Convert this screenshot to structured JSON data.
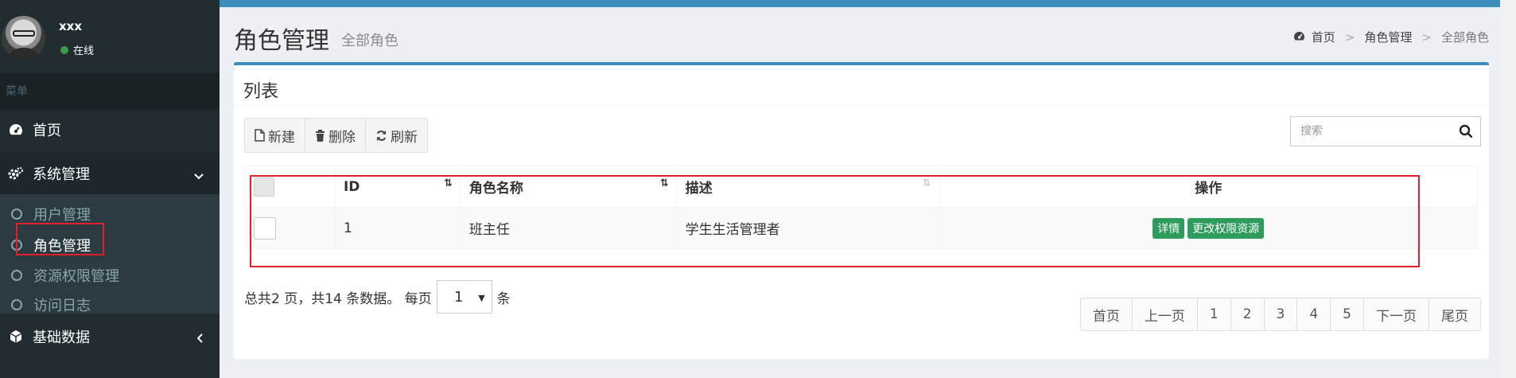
{
  "user": {
    "name": "xxx",
    "status": "在线"
  },
  "sidebar": {
    "header": "菜单",
    "home": "首页",
    "system": "系统管理",
    "sub_items": [
      "用户管理",
      "角色管理",
      "资源权限管理",
      "访问日志"
    ],
    "basic": "基础数据"
  },
  "page": {
    "title": "角色管理",
    "subtitle": "全部角色"
  },
  "breadcrumb": [
    "首页",
    "角色管理",
    "全部角色"
  ],
  "box": {
    "title": "列表"
  },
  "toolbar": {
    "new": "新建",
    "delete": "删除",
    "refresh": "刷新"
  },
  "search": {
    "placeholder": "搜索"
  },
  "table": {
    "headers": [
      "ID",
      "角色名称",
      "描述",
      "操作"
    ],
    "rows": [
      {
        "id": "1",
        "name": "班主任",
        "desc": "学生生活管理者",
        "actions": [
          "详情",
          "更改权限资源"
        ]
      }
    ]
  },
  "footer": {
    "summary_prefix": "总共2 页，共14 条数据。 每页",
    "page_size": "1",
    "summary_suffix": "条"
  },
  "pagination": [
    "首页",
    "上一页",
    "1",
    "2",
    "3",
    "4",
    "5",
    "下一页",
    "尾页"
  ],
  "colors": {
    "accent": "#3c8dbc",
    "sidebar": "#222d32",
    "success": "#2e9c5c",
    "highlight": "#e0202a"
  }
}
